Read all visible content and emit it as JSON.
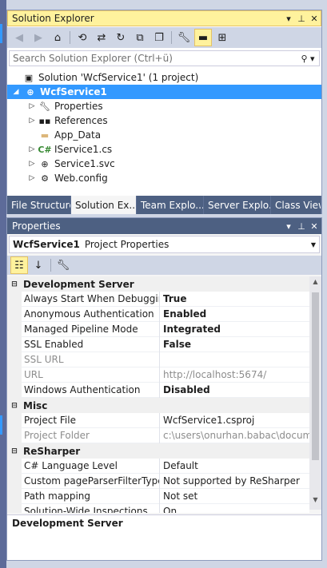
{
  "solution_explorer": {
    "title": "Solution Explorer",
    "title_controls": [
      "▾",
      "⊥",
      "✕"
    ],
    "toolbar_icons": [
      "back-icon",
      "forward-icon",
      "home-icon",
      "history-icon",
      "sync-icon",
      "refresh-icon",
      "collapse-all-icon",
      "show-all-files-icon",
      "properties-icon",
      "preview-icon",
      "class-diagram-icon"
    ],
    "search": {
      "placeholder": "Search Solution Explorer (Ctrl+ü)",
      "value": ""
    },
    "tree": [
      {
        "label": "Solution 'WcfService1' (1 project)",
        "indent": 0,
        "expander": "",
        "icon": "solution-icon"
      },
      {
        "label": "WcfService1",
        "indent": 1,
        "expander": "◢",
        "icon": "web-project-icon",
        "selected": true
      },
      {
        "label": "Properties",
        "indent": 2,
        "expander": "▷",
        "icon": "wrench-icon"
      },
      {
        "label": "References",
        "indent": 2,
        "expander": "▷",
        "icon": "references-icon"
      },
      {
        "label": "App_Data",
        "indent": 2,
        "expander": "",
        "icon": "folder-icon"
      },
      {
        "label": "IService1.cs",
        "indent": 2,
        "expander": "▷",
        "icon": "csharp-file-icon"
      },
      {
        "label": "Service1.svc",
        "indent": 2,
        "expander": "▷",
        "icon": "service-file-icon"
      },
      {
        "label": "Web.config",
        "indent": 2,
        "expander": "▷",
        "icon": "config-file-icon"
      }
    ],
    "tabs": [
      {
        "label": "File Structure",
        "active": false
      },
      {
        "label": "Solution Ex...",
        "active": true
      },
      {
        "label": "Team Explo...",
        "active": false
      },
      {
        "label": "Server Explo...",
        "active": false
      },
      {
        "label": "Class View",
        "active": false
      }
    ]
  },
  "properties": {
    "title": "Properties",
    "title_controls": [
      "▾",
      "⊥",
      "✕"
    ],
    "object_name": "WcfService1",
    "object_type": "Project Properties",
    "categories": [
      {
        "name": "Development Server",
        "rows": [
          {
            "name": "Always Start When Debugging",
            "value": "True",
            "bold": true,
            "disabled": false
          },
          {
            "name": "Anonymous Authentication",
            "value": "Enabled",
            "bold": true,
            "disabled": false
          },
          {
            "name": "Managed Pipeline Mode",
            "value": "Integrated",
            "bold": true,
            "disabled": false
          },
          {
            "name": "SSL Enabled",
            "value": "False",
            "bold": true,
            "disabled": false
          },
          {
            "name": "SSL URL",
            "value": "",
            "bold": false,
            "disabled": true
          },
          {
            "name": "URL",
            "value": "http://localhost:5674/",
            "bold": false,
            "disabled": true
          },
          {
            "name": "Windows Authentication",
            "value": "Disabled",
            "bold": true,
            "disabled": false
          }
        ]
      },
      {
        "name": "Misc",
        "rows": [
          {
            "name": "Project File",
            "value": "WcfService1.csproj",
            "bold": false,
            "disabled": false
          },
          {
            "name": "Project Folder",
            "value": "c:\\users\\onurhan.babac\\documen",
            "bold": false,
            "disabled": true
          }
        ]
      },
      {
        "name": "ReSharper",
        "rows": [
          {
            "name": "C# Language Level",
            "value": "Default",
            "bold": false,
            "disabled": false
          },
          {
            "name": "Custom pageParserFilterType ha",
            "value": "Not supported by ReSharper",
            "bold": false,
            "disabled": false
          },
          {
            "name": "Path mapping",
            "value": "Not set",
            "bold": false,
            "disabled": false
          },
          {
            "name": "Solution-Wide Inspections",
            "value": "On",
            "bold": false,
            "disabled": false
          }
        ]
      }
    ],
    "description_title": "Development Server"
  }
}
